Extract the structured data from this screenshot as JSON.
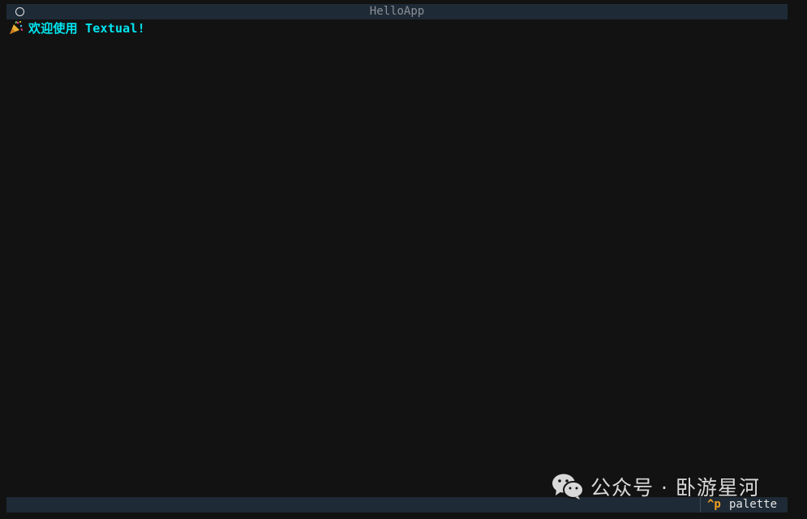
{
  "app": {
    "title": "HelloApp"
  },
  "header": {
    "icon": "circle-icon"
  },
  "content": {
    "icon": "party-popper-icon",
    "greeting": "欢迎使用 Textual!"
  },
  "footer": {
    "palette_key": "^p",
    "palette_label": "palette"
  },
  "watermark": {
    "icon": "wechat-icon",
    "text": "公众号 · 卧游星河"
  },
  "colors": {
    "background": "#121212",
    "bar": "#1e2a35",
    "greeting": "#00e6f0",
    "key_accent": "#f0a020",
    "title_text": "#8a9099"
  }
}
